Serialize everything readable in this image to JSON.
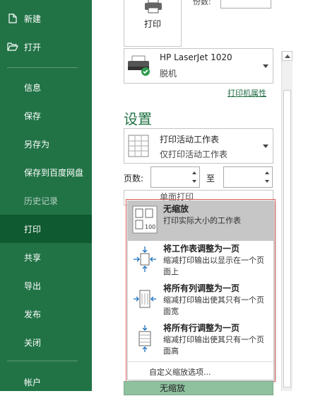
{
  "sidebar": {
    "top_items": [
      {
        "label": "新建",
        "icon": "new-document-icon"
      },
      {
        "label": "打开",
        "icon": "open-folder-icon"
      }
    ],
    "items": [
      {
        "label": "信息"
      },
      {
        "label": "保存"
      },
      {
        "label": "另存为"
      },
      {
        "label": "保存到百度网盘"
      },
      {
        "label": "历史记录"
      },
      {
        "label": "打印"
      },
      {
        "label": "共享"
      },
      {
        "label": "导出"
      },
      {
        "label": "发布"
      },
      {
        "label": "关闭"
      }
    ],
    "account": "帐户",
    "active": "打印"
  },
  "print": {
    "button_label": "打印",
    "copies_label": "份数:"
  },
  "printer": {
    "name": "HP LaserJet 1020",
    "status": "脱机",
    "properties_link": "打印机属性"
  },
  "settings": {
    "title": "设置",
    "active_sheet": {
      "title": "打印活动工作表",
      "description": "仅打印活动工作表"
    },
    "pages_label": "页数:",
    "to_label": "至",
    "behind_option": "单面打印"
  },
  "scaling_dropdown": {
    "options": [
      {
        "title": "无缩放",
        "description": "打印实际大小的工作表",
        "icon": "no-scaling-icon",
        "selected": true
      },
      {
        "title": "将工作表调整为一页",
        "description": "缩减打印输出以显示在一个页面上",
        "icon": "fit-sheet-icon",
        "selected": false
      },
      {
        "title": "将所有列调整为一页",
        "description": "缩减打印输出使其只有一个页面宽",
        "icon": "fit-columns-icon",
        "selected": false
      },
      {
        "title": "将所有行调整为一页",
        "description": "缩减打印输出使其只有一个页面高",
        "icon": "fit-rows-icon",
        "selected": false
      }
    ],
    "custom_label": "自定义缩放选项...",
    "current_value": "无缩放"
  },
  "colors": {
    "brand": "#217346",
    "active_nav": "#0f5a31",
    "highlight_outline": "#e05a5a"
  }
}
